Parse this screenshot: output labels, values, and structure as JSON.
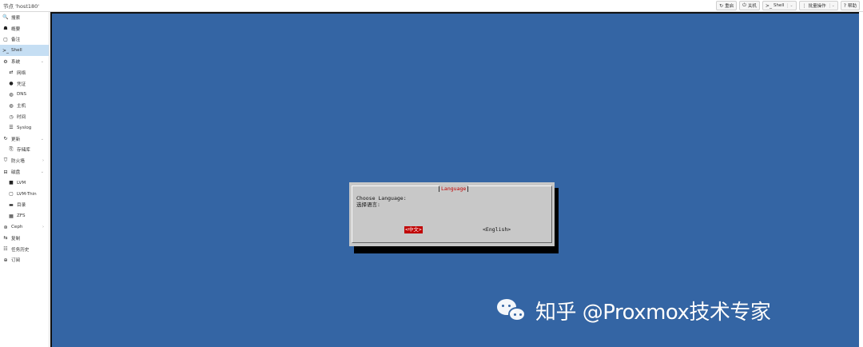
{
  "topbar": {
    "node_title": "节点 'host180'",
    "buttons": [
      {
        "icon": "↻",
        "label": "重启",
        "dropdown": false
      },
      {
        "icon": "⏻",
        "label": "关机",
        "dropdown": false
      },
      {
        "icon": ">_",
        "label": "Shell",
        "dropdown": true
      },
      {
        "icon": "⋮",
        "label": "批量操作",
        "dropdown": true
      },
      {
        "icon": "?",
        "label": "帮助",
        "dropdown": false
      }
    ]
  },
  "sidebar": {
    "items": [
      {
        "label": "搜索",
        "icon": "🔍",
        "level": 0,
        "arrow": ""
      },
      {
        "label": "概要",
        "icon": "☗",
        "level": 0,
        "arrow": ""
      },
      {
        "label": "备注",
        "icon": "▢",
        "level": 0,
        "arrow": ""
      },
      {
        "label": "Shell",
        "icon": ">_",
        "level": 0,
        "arrow": "",
        "active": true
      },
      {
        "label": "系统",
        "icon": "⚙",
        "level": 0,
        "arrow": "⌄"
      },
      {
        "label": "网络",
        "icon": "⇄",
        "level": 1,
        "arrow": ""
      },
      {
        "label": "凭证",
        "icon": "●",
        "level": 1,
        "arrow": ""
      },
      {
        "label": "DNS",
        "icon": "◍",
        "level": 1,
        "arrow": ""
      },
      {
        "label": "主机",
        "icon": "◍",
        "level": 1,
        "arrow": ""
      },
      {
        "label": "时间",
        "icon": "◷",
        "level": 1,
        "arrow": ""
      },
      {
        "label": "Syslog",
        "icon": "☰",
        "level": 1,
        "arrow": ""
      },
      {
        "label": "更新",
        "icon": "↻",
        "level": 0,
        "arrow": "⌄"
      },
      {
        "label": "存储库",
        "icon": "⎘",
        "level": 1,
        "arrow": ""
      },
      {
        "label": "防火墙",
        "icon": "⛉",
        "level": 0,
        "arrow": "›"
      },
      {
        "label": "磁盘",
        "icon": "⊟",
        "level": 0,
        "arrow": "⌄"
      },
      {
        "label": "LVM",
        "icon": "■",
        "level": 1,
        "arrow": ""
      },
      {
        "label": "LVM-Thin",
        "icon": "▢",
        "level": 1,
        "arrow": ""
      },
      {
        "label": "目录",
        "icon": "▬",
        "level": 1,
        "arrow": ""
      },
      {
        "label": "ZFS",
        "icon": "▦",
        "level": 1,
        "arrow": ""
      },
      {
        "label": "Ceph",
        "icon": "⊛",
        "level": 0,
        "arrow": "›"
      },
      {
        "label": "复制",
        "icon": "⇆",
        "level": 0,
        "arrow": ""
      },
      {
        "label": "任务历史",
        "icon": "☷",
        "level": 0,
        "arrow": ""
      },
      {
        "label": "订阅",
        "icon": "⊕",
        "level": 0,
        "arrow": ""
      }
    ]
  },
  "terminal": {
    "background": "#3465a4",
    "dialog": {
      "title": "Language",
      "prompt_en": "Choose Language:",
      "prompt_zh": "选择语言:",
      "option_selected": "<中文>",
      "option_other": "<English>"
    }
  },
  "watermark": {
    "text": "知乎 @Proxmox技术专家"
  },
  "colors": {
    "accent_active": "#c5def3",
    "terminal_blue": "#3465a4",
    "dialog_gray": "#c8c8c8",
    "highlight_red": "#c00000"
  }
}
